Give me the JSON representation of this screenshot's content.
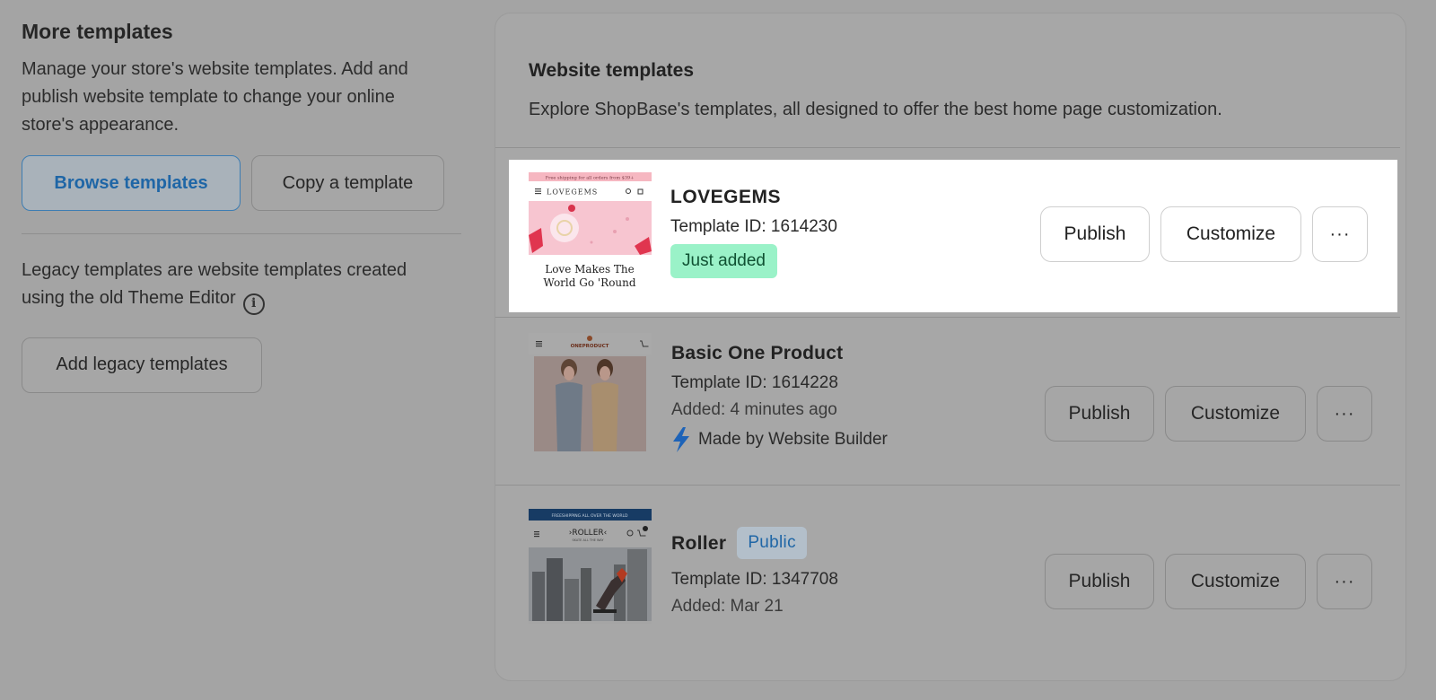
{
  "left": {
    "title": "More templates",
    "description": "Manage your store's website templates. Add and publish website template to change your online store's appearance.",
    "browse_label": "Browse templates",
    "copy_label": "Copy a template",
    "legacy_text": "Legacy templates are website templates created using the old Theme Editor",
    "info_icon": "info-icon",
    "add_legacy_label": "Add legacy templates"
  },
  "card": {
    "title": "Website templates",
    "subtitle": "Explore ShopBase's templates, all designed to offer the best home page customization."
  },
  "templates": [
    {
      "name": "LOVEGEMS",
      "template_id": "Template ID: 1614230",
      "badge": "Just added",
      "publish_label": "Publish",
      "customize_label": "Customize",
      "more_label": "···",
      "thumb": {
        "banner": "Free shipping for all orders from $39+",
        "brand": "LOVEGEMS",
        "headline1": "Love Makes The",
        "headline2": "World Go 'Round"
      }
    },
    {
      "name": "Basic One Product",
      "template_id": "Template ID: 1614228",
      "added": "Added: 4 minutes ago",
      "builder_label": "Made by Website Builder",
      "publish_label": "Publish",
      "customize_label": "Customize",
      "more_label": "···",
      "thumb": {
        "brand": "ONEPRODUCT"
      }
    },
    {
      "name": "Roller",
      "badge": "Public",
      "template_id": "Template ID: 1347708",
      "added": "Added: Mar 21",
      "publish_label": "Publish",
      "customize_label": "Customize",
      "more_label": "···",
      "thumb": {
        "banner": "FREESHIPPING ALL OVER THE WORLD",
        "brand": "›ROLLER‹",
        "tagline": "SKATE ALL THE WAY"
      }
    }
  ],
  "colors": {
    "overlay_bg": "#a4a4a4",
    "primary_blue": "#1f66a6",
    "success_badge": "#9af2c8",
    "builder_bolt": "#1d63b8"
  }
}
